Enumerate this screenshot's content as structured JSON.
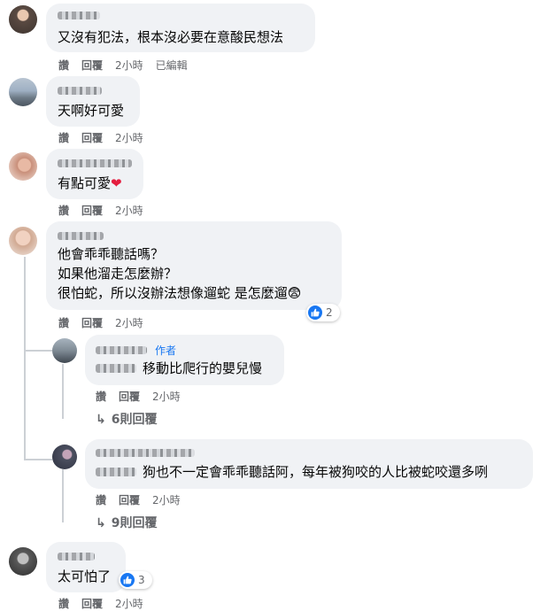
{
  "comments": [
    {
      "text": "又沒有犯法，根本沒必要在意酸民想法",
      "actions": [
        "讚",
        "回覆",
        "2小時",
        "已編輯"
      ]
    },
    {
      "text": "天啊好可愛",
      "actions": [
        "讚",
        "回覆",
        "2小時"
      ]
    },
    {
      "text": "有點可愛",
      "emoji": "❤",
      "actions": [
        "讚",
        "回覆",
        "2小時"
      ]
    },
    {
      "lines": [
        "他會乖乖聽話嗎？",
        "如果他溜走怎麼辦？",
        "很怕蛇，所以沒辦法想像遛蛇 是怎麼遛"
      ],
      "emoji": "😨",
      "actions": [
        "讚",
        "回覆",
        "2小時"
      ],
      "reaction_count": "2"
    },
    {
      "text": "太可怕了",
      "actions": [
        "讚",
        "回覆",
        "2小時"
      ],
      "reaction_count": "3"
    }
  ],
  "replies": [
    {
      "author_tag": "作者",
      "text": "移動比爬行的嬰兒慢",
      "actions": [
        "讚",
        "回覆",
        "2小時"
      ],
      "more_label": "6則回覆"
    },
    {
      "text": "狗也不一定會乖乖聽話阿，每年被狗咬的人比被蛇咬還多咧",
      "actions": [
        "讚",
        "回覆",
        "2小時"
      ],
      "more_label": "9則回覆"
    }
  ],
  "colors": {
    "bubble": "#f0f2f5",
    "meta": "#65676b",
    "like": "#1877f2",
    "heart": "#e41e3f"
  },
  "icons": {
    "like": "thumbs-up-icon",
    "reply_arrow": "reply-arrow-icon"
  }
}
